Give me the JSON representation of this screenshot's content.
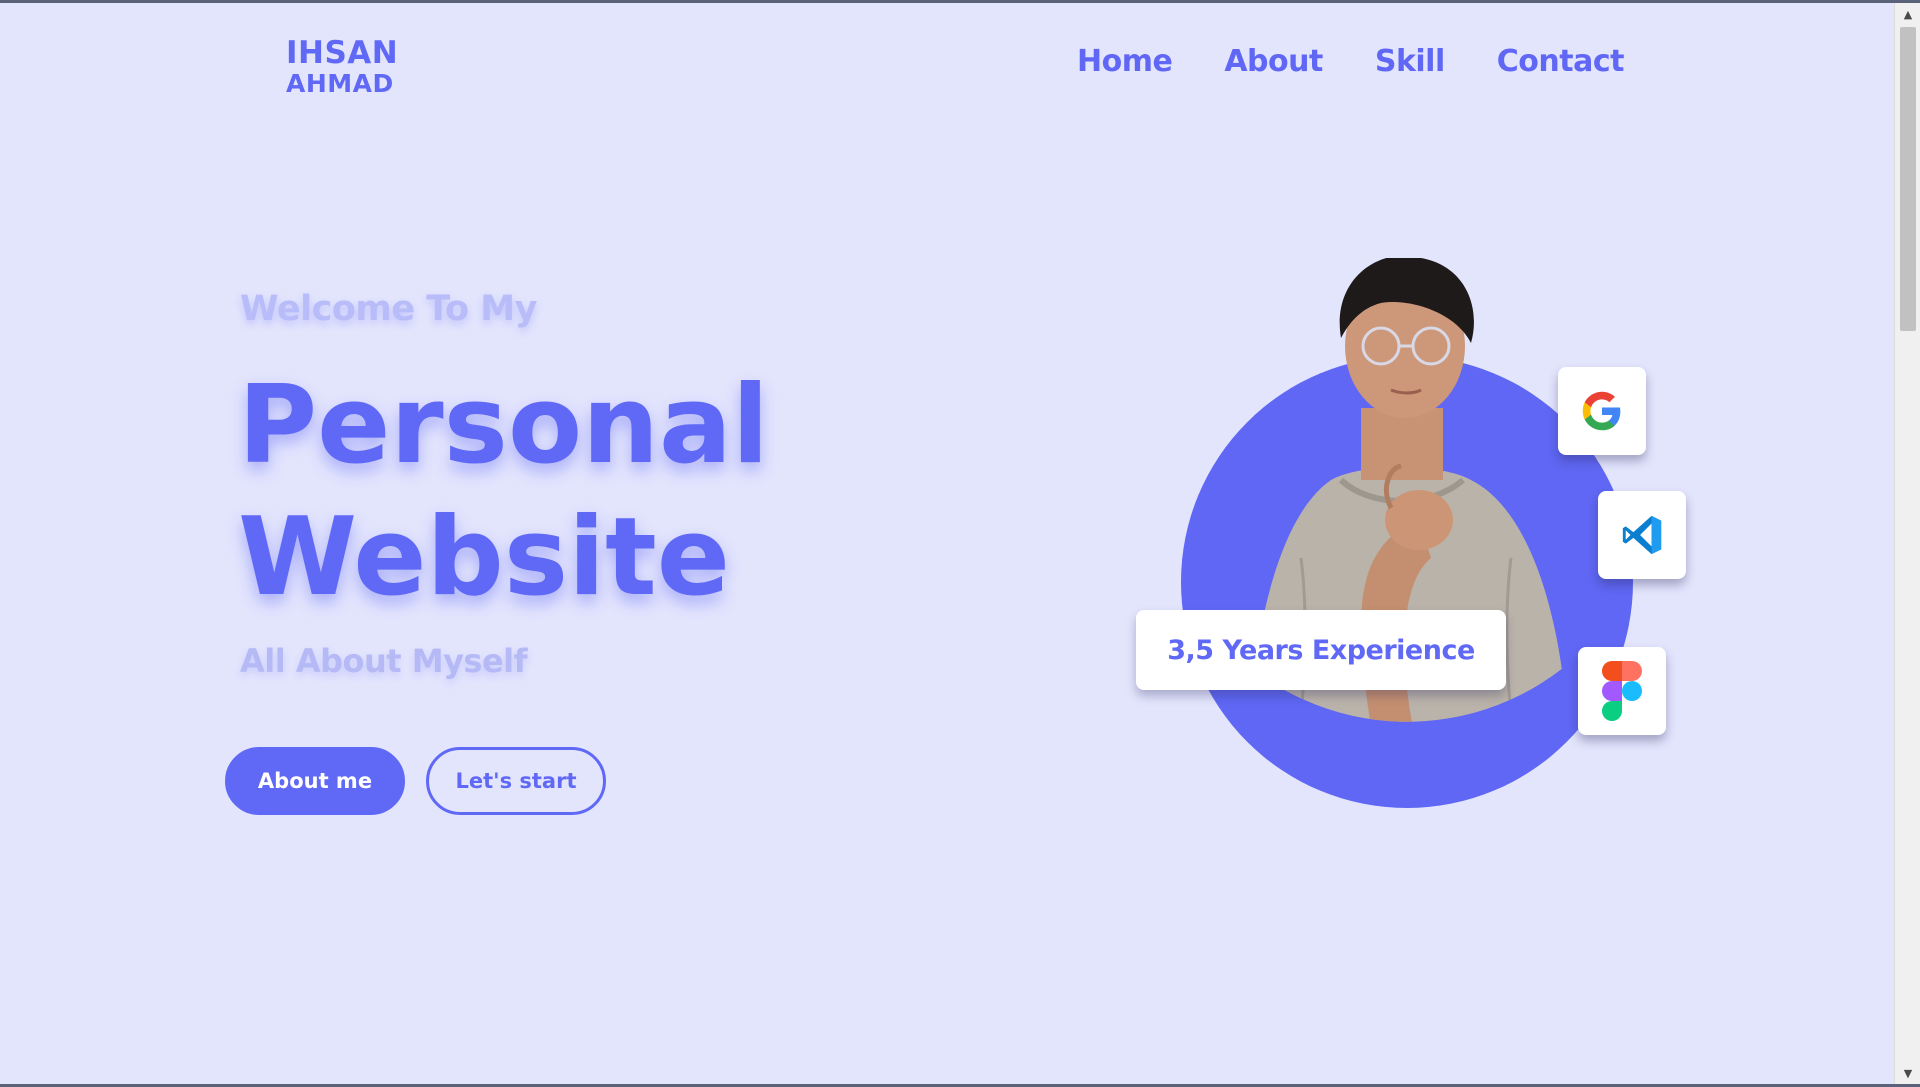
{
  "logo": {
    "line1": "IHSAN",
    "line2": "AHMAD"
  },
  "nav": {
    "items": [
      "Home",
      "About",
      "Skill",
      "Contact"
    ]
  },
  "hero": {
    "welcome": "Welcome To My",
    "title_line1": "Personal",
    "title_line2": "Website",
    "subtitle": "All About Myself",
    "primary_button": "About me",
    "secondary_button": "Let's start",
    "experience": "3,5 Years Experience"
  },
  "badges": [
    "google-icon",
    "vscode-icon",
    "figma-icon"
  ],
  "colors": {
    "background": "#e3e5fd",
    "accent": "#6068f6",
    "muted_text": "#b8bcf8",
    "card": "#ffffff"
  }
}
